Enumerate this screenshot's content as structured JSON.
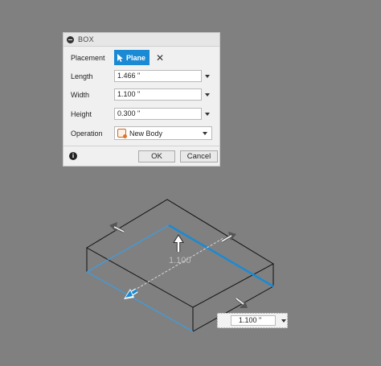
{
  "dialog": {
    "title": "BOX",
    "placement": {
      "label": "Placement",
      "button_label": "Plane"
    },
    "length": {
      "label": "Length",
      "value": "1.466 \""
    },
    "width": {
      "label": "Width",
      "value": "1.100 \""
    },
    "height": {
      "label": "Height",
      "value": "0.300 \""
    },
    "operation": {
      "label": "Operation",
      "value": "New Body"
    },
    "ok_label": "OK",
    "cancel_label": "Cancel",
    "info_glyph": "i"
  },
  "viewport": {
    "dimension_text": "1.100",
    "dimension_input_value": "1.100 \""
  },
  "colors": {
    "background": "#808080",
    "accent": "#1a8ad4",
    "edge_highlight": "#3a9ee6"
  }
}
